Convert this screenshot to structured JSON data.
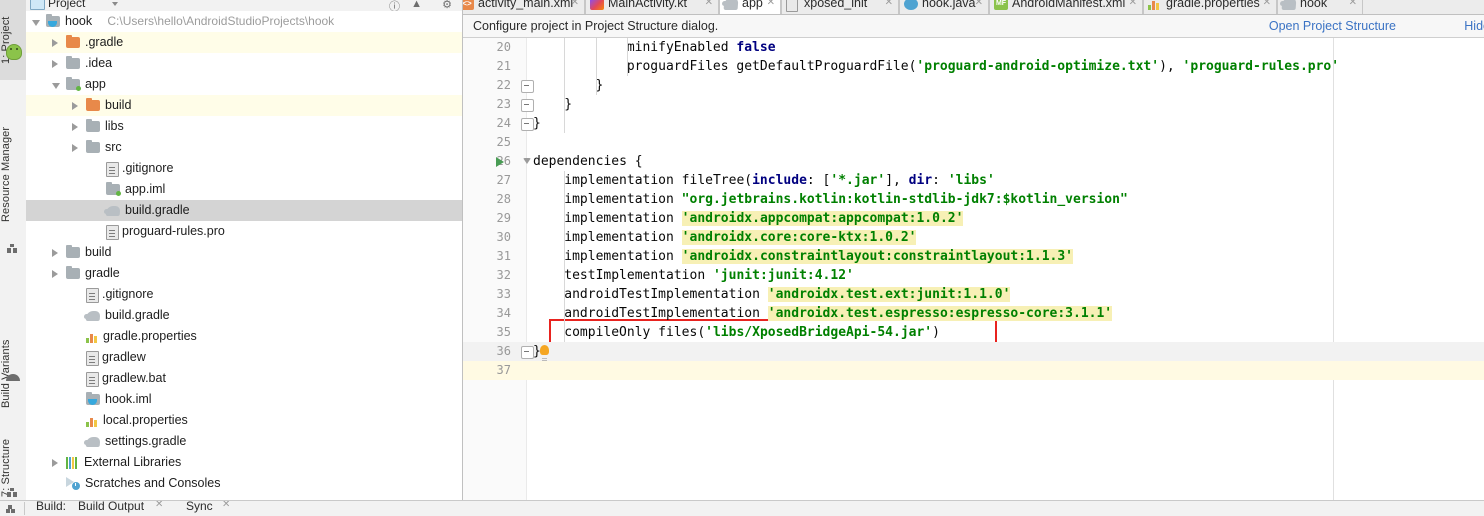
{
  "window": {
    "ide": "Android Studio"
  },
  "toolstrip": {
    "tabs": [
      {
        "label": "1: Project",
        "selected": true,
        "icon": "project-icon"
      },
      {
        "label": "Resource Manager",
        "selected": false,
        "icon": "resource-manager-icon"
      },
      {
        "label": "Build Variants",
        "selected": false,
        "icon": "build-variants-icon"
      },
      {
        "label": "7: Structure",
        "selected": false,
        "icon": "structure-icon"
      }
    ]
  },
  "project_panel": {
    "title": "Project",
    "tree": [
      {
        "label": "hook",
        "path": "C:\\Users\\hello\\AndroidStudioProjects\\hook",
        "depth": 0,
        "icon": "module-java-folder-icon",
        "arrow": "open",
        "row_style": "plain"
      },
      {
        "label": ".gradle",
        "path": "",
        "depth": 1,
        "icon": "folder-orange-icon",
        "arrow": "closed",
        "row_style": "alt"
      },
      {
        "label": ".idea",
        "path": "",
        "depth": 1,
        "icon": "folder-gray-icon",
        "arrow": "closed",
        "row_style": "plain"
      },
      {
        "label": "app",
        "path": "",
        "depth": 1,
        "icon": "module-folder-icon",
        "arrow": "open",
        "row_style": "plain"
      },
      {
        "label": "build",
        "path": "",
        "depth": 2,
        "icon": "folder-orange-icon",
        "arrow": "closed",
        "row_style": "alt"
      },
      {
        "label": "libs",
        "path": "",
        "depth": 2,
        "icon": "folder-gray-icon",
        "arrow": "closed",
        "row_style": "plain"
      },
      {
        "label": "src",
        "path": "",
        "depth": 2,
        "icon": "folder-gray-icon",
        "arrow": "closed",
        "row_style": "plain"
      },
      {
        "label": ".gitignore",
        "path": "",
        "depth": 3,
        "icon": "file-icon",
        "arrow": "none",
        "row_style": "plain"
      },
      {
        "label": "app.iml",
        "path": "",
        "depth": 3,
        "icon": "module-folder-icon",
        "arrow": "none",
        "row_style": "plain"
      },
      {
        "label": "build.gradle",
        "path": "",
        "depth": 3,
        "icon": "gradle-icon",
        "arrow": "none",
        "row_style": "sel"
      },
      {
        "label": "proguard-rules.pro",
        "path": "",
        "depth": 3,
        "icon": "file-icon",
        "arrow": "none",
        "row_style": "plain"
      },
      {
        "label": "build",
        "path": "",
        "depth": 1,
        "icon": "folder-gray-icon",
        "arrow": "closed",
        "row_style": "plain"
      },
      {
        "label": "gradle",
        "path": "",
        "depth": 1,
        "icon": "folder-gray-icon",
        "arrow": "closed",
        "row_style": "plain"
      },
      {
        "label": ".gitignore",
        "path": "",
        "depth": 2,
        "icon": "file-icon",
        "arrow": "none",
        "row_style": "plain"
      },
      {
        "label": "build.gradle",
        "path": "",
        "depth": 2,
        "icon": "gradle-icon",
        "arrow": "none",
        "row_style": "plain"
      },
      {
        "label": "gradle.properties",
        "path": "",
        "depth": 2,
        "icon": "properties-icon",
        "arrow": "none",
        "row_style": "plain"
      },
      {
        "label": "gradlew",
        "path": "",
        "depth": 2,
        "icon": "file-icon",
        "arrow": "none",
        "row_style": "plain"
      },
      {
        "label": "gradlew.bat",
        "path": "",
        "depth": 2,
        "icon": "file-icon",
        "arrow": "none",
        "row_style": "plain"
      },
      {
        "label": "hook.iml",
        "path": "",
        "depth": 2,
        "icon": "module-java-folder-icon",
        "arrow": "none",
        "row_style": "plain"
      },
      {
        "label": "local.properties",
        "path": "",
        "depth": 2,
        "icon": "properties-icon",
        "arrow": "none",
        "row_style": "plain"
      },
      {
        "label": "settings.gradle",
        "path": "",
        "depth": 2,
        "icon": "gradle-icon",
        "arrow": "none",
        "row_style": "plain"
      },
      {
        "label": "External Libraries",
        "path": "",
        "depth": 1,
        "icon": "external-libraries-icon",
        "arrow": "closed",
        "row_style": "plain"
      },
      {
        "label": "Scratches and Consoles",
        "path": "",
        "depth": 1,
        "icon": "scratches-icon",
        "arrow": "none",
        "row_style": "plain"
      }
    ]
  },
  "editor": {
    "tabs": [
      {
        "label": "activity_main.xml",
        "icon": "xml-file-icon",
        "active": false
      },
      {
        "label": "MainActivity.kt",
        "icon": "kotlin-file-icon",
        "active": false
      },
      {
        "label": "app",
        "icon": "gradle-icon",
        "active": true
      },
      {
        "label": "xposed_init",
        "icon": "text-file-icon",
        "active": false
      },
      {
        "label": "hook.java",
        "icon": "java-file-icon",
        "active": false
      },
      {
        "label": "AndroidManifest.xml",
        "icon": "manifest-file-icon",
        "active": false
      },
      {
        "label": "gradle.properties",
        "icon": "properties-icon",
        "active": false
      },
      {
        "label": "hook",
        "icon": "gradle-icon",
        "active": false
      }
    ],
    "notification": {
      "message": "Configure project in Project Structure dialog.",
      "open_link": "Open Project Structure",
      "hide_link": "Hide"
    },
    "lines": [
      {
        "num": "20",
        "indent": 12,
        "tokens": [
          {
            "t": "minifyEnabled ",
            "c": "plain"
          },
          {
            "t": "false",
            "c": "kw"
          }
        ],
        "fold": "none",
        "style": "plain"
      },
      {
        "num": "21",
        "indent": 12,
        "tokens": [
          {
            "t": "proguardFiles getDefaultProguardFile(",
            "c": "plain"
          },
          {
            "t": "'proguard-android-optimize.txt'",
            "c": "str"
          },
          {
            "t": "), ",
            "c": "plain"
          },
          {
            "t": "'proguard-rules.pro'",
            "c": "str"
          }
        ],
        "fold": "none",
        "style": "plain"
      },
      {
        "num": "22",
        "indent": 8,
        "tokens": [
          {
            "t": "}",
            "c": "plain"
          }
        ],
        "fold": "minus",
        "style": "plain"
      },
      {
        "num": "23",
        "indent": 4,
        "tokens": [
          {
            "t": "}",
            "c": "plain"
          }
        ],
        "fold": "minus",
        "style": "plain"
      },
      {
        "num": "24",
        "indent": 0,
        "tokens": [
          {
            "t": "}",
            "c": "plain"
          }
        ],
        "fold": "minus",
        "style": "plain"
      },
      {
        "num": "25",
        "indent": 0,
        "tokens": [],
        "fold": "none",
        "style": "plain"
      },
      {
        "num": "26",
        "indent": 0,
        "tokens": [
          {
            "t": "dependencies {",
            "c": "plain"
          }
        ],
        "fold": "tri",
        "style": "plain",
        "run_arrow": true
      },
      {
        "num": "27",
        "indent": 4,
        "tokens": [
          {
            "t": "implementation fileTree(",
            "c": "plain"
          },
          {
            "t": "include",
            "c": "kw"
          },
          {
            "t": ": [",
            "c": "plain"
          },
          {
            "t": "'*.jar'",
            "c": "str"
          },
          {
            "t": "], ",
            "c": "plain"
          },
          {
            "t": "dir",
            "c": "kw"
          },
          {
            "t": ": ",
            "c": "plain"
          },
          {
            "t": "'libs'",
            "c": "str"
          }
        ],
        "fold": "none",
        "style": "plain"
      },
      {
        "num": "28",
        "indent": 4,
        "tokens": [
          {
            "t": "implementation ",
            "c": "plain"
          },
          {
            "t": "\"org.jetbrains.kotlin:kotlin-stdlib-jdk7:$kotlin_version\"",
            "c": "str"
          }
        ],
        "fold": "none",
        "style": "plain"
      },
      {
        "num": "29",
        "indent": 4,
        "tokens": [
          {
            "t": "implementation ",
            "c": "plain"
          },
          {
            "t": "'androidx.appcompat:appcompat:1.0.2'",
            "c": "str",
            "mark": true
          }
        ],
        "fold": "none",
        "style": "plain"
      },
      {
        "num": "30",
        "indent": 4,
        "tokens": [
          {
            "t": "implementation ",
            "c": "plain"
          },
          {
            "t": "'androidx.core:core-ktx:1.0.2'",
            "c": "str",
            "mark": true
          }
        ],
        "fold": "none",
        "style": "plain"
      },
      {
        "num": "31",
        "indent": 4,
        "tokens": [
          {
            "t": "implementation ",
            "c": "plain"
          },
          {
            "t": "'androidx.constraintlayout:constraintlayout:1.1.3'",
            "c": "str",
            "mark": true
          }
        ],
        "fold": "none",
        "style": "plain"
      },
      {
        "num": "32",
        "indent": 4,
        "tokens": [
          {
            "t": "testImplementation ",
            "c": "plain"
          },
          {
            "t": "'junit:junit:4.12'",
            "c": "str"
          }
        ],
        "fold": "none",
        "style": "plain"
      },
      {
        "num": "33",
        "indent": 4,
        "tokens": [
          {
            "t": "androidTestImplementation ",
            "c": "plain"
          },
          {
            "t": "'androidx.test.ext:junit:1.1.0'",
            "c": "str",
            "mark": true
          }
        ],
        "fold": "none",
        "style": "plain"
      },
      {
        "num": "34",
        "indent": 4,
        "tokens": [
          {
            "t": "androidTestImplementation ",
            "c": "plain"
          },
          {
            "t": "'androidx.test.espresso:espresso-core:3.1.1'",
            "c": "str",
            "mark": true
          }
        ],
        "fold": "none",
        "style": "plain"
      },
      {
        "num": "35",
        "indent": 4,
        "tokens": [
          {
            "t": "compileOnly files(",
            "c": "plain"
          },
          {
            "t": "'libs/XposedBridgeApi-54.jar'",
            "c": "str"
          },
          {
            "t": ")",
            "c": "plain"
          }
        ],
        "fold": "none",
        "style": "plain"
      },
      {
        "num": "36",
        "indent": 0,
        "tokens": [
          {
            "t": "}",
            "c": "plain"
          }
        ],
        "fold": "minus",
        "style": "g",
        "bulb": true
      },
      {
        "num": "37",
        "indent": 0,
        "tokens": [],
        "fold": "none",
        "style": "cur"
      }
    ],
    "annotation": {
      "label": "red-highlight-box",
      "color": "#e8231f"
    }
  },
  "bottom_bar": {
    "items": [
      {
        "label": "Build:",
        "active": false
      },
      {
        "label": "Build Output",
        "active": true,
        "closable": true
      },
      {
        "label": "Sync",
        "active": false,
        "closable": true
      }
    ]
  }
}
